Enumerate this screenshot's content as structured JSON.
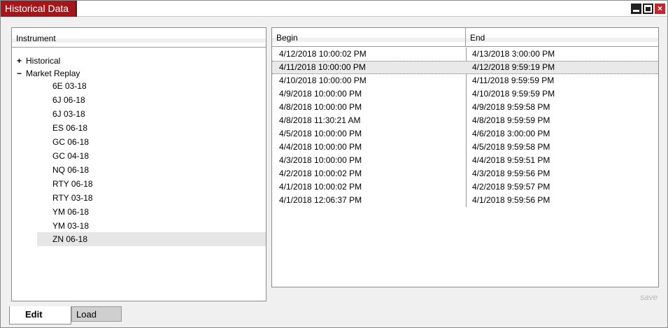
{
  "window": {
    "title": "Historical Data",
    "controls": {
      "minimize": "minimize",
      "maximize": "maximize",
      "close": "×"
    }
  },
  "instrument_panel": {
    "header": "Instrument",
    "tree": [
      {
        "toggle": "+",
        "label": "Historical"
      },
      {
        "toggle": "−",
        "label": "Market Replay"
      }
    ],
    "replay_children": [
      "6E 03-18",
      "6J 06-18",
      "6J 03-18",
      "ES 06-18",
      "GC 06-18",
      "GC 04-18",
      "NQ 06-18",
      "RTY 06-18",
      "RTY 03-18",
      "YM 06-18",
      "YM 03-18",
      "ZN 06-18"
    ],
    "selected_child_index": 11
  },
  "range_grid": {
    "columns": {
      "begin": "Begin",
      "end": "End"
    },
    "rows": [
      {
        "begin": "4/12/2018 10:00:02 PM",
        "end": "4/13/2018 3:00:00 PM"
      },
      {
        "begin": "4/11/2018 10:00:00 PM",
        "end": "4/12/2018 9:59:19 PM"
      },
      {
        "begin": "4/10/2018 10:00:00 PM",
        "end": "4/11/2018 9:59:59 PM"
      },
      {
        "begin": "4/9/2018 10:00:00 PM",
        "end": "4/10/2018 9:59:59 PM"
      },
      {
        "begin": "4/8/2018 10:00:00 PM",
        "end": "4/9/2018 9:59:58 PM"
      },
      {
        "begin": "4/8/2018 11:30:21 AM",
        "end": "4/8/2018 9:59:59 PM"
      },
      {
        "begin": "4/5/2018 10:00:00 PM",
        "end": "4/6/2018 3:00:00 PM"
      },
      {
        "begin": "4/4/2018 10:00:00 PM",
        "end": "4/5/2018 9:59:58 PM"
      },
      {
        "begin": "4/3/2018 10:00:00 PM",
        "end": "4/4/2018 9:59:51 PM"
      },
      {
        "begin": "4/2/2018 10:00:02 PM",
        "end": "4/3/2018 9:59:56 PM"
      },
      {
        "begin": "4/1/2018 10:00:02 PM",
        "end": "4/2/2018 9:59:57 PM"
      },
      {
        "begin": "4/1/2018 12:06:37 PM",
        "end": "4/1/2018 9:59:56 PM"
      }
    ],
    "selected_row_index": 1
  },
  "footer": {
    "save_label": "save",
    "tabs": [
      {
        "label": "Edit",
        "active": true
      },
      {
        "label": "Load",
        "active": false
      }
    ]
  },
  "colors": {
    "title_accent": "#a4161a",
    "selection": "#e6e6e6",
    "save_text": "#b8b8b8"
  }
}
